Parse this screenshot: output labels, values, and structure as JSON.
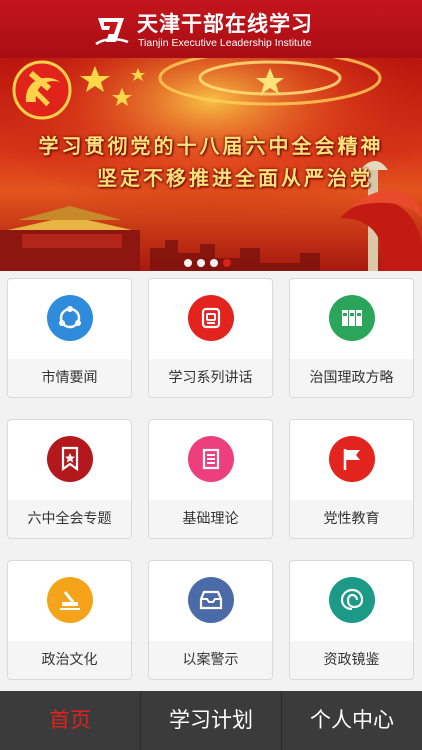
{
  "header": {
    "title": "天津干部在线学习",
    "subtitle": "Tianjin Executive Leadership Institute",
    "logo_icon": "tjel-logo-icon"
  },
  "banner": {
    "line1": "学习贯彻党的十八届六中全会精神",
    "line2": "坚定不移推进全面从严治党",
    "slides": 4,
    "active_slide": 4,
    "colors": {
      "text": "#ffe27a",
      "bg": "#c4151c"
    }
  },
  "menu": [
    {
      "label": "市情要闻",
      "icon": "network-icon",
      "color": "#2f8bdc"
    },
    {
      "label": "学习系列讲话",
      "icon": "notebook-icon",
      "color": "#e2231e"
    },
    {
      "label": "治国理政方略",
      "icon": "binders-icon",
      "color": "#2aa55a"
    },
    {
      "label": "六中全会专题",
      "icon": "bookmark-star-icon",
      "color": "#b3181d"
    },
    {
      "label": "基础理论",
      "icon": "document-icon",
      "color": "#ee3f7d"
    },
    {
      "label": "党性教育",
      "icon": "flag-icon",
      "color": "#e2231e"
    },
    {
      "label": "政治文化",
      "icon": "stamp-icon",
      "color": "#f5a31a"
    },
    {
      "label": "以案警示",
      "icon": "inbox-icon",
      "color": "#4a6aa8"
    },
    {
      "label": "资政镜鉴",
      "icon": "spiral-icon",
      "color": "#1d9a87"
    }
  ],
  "tabs": [
    {
      "label": "首页",
      "active": true
    },
    {
      "label": "学习计划",
      "active": false
    },
    {
      "label": "个人中心",
      "active": false
    }
  ]
}
